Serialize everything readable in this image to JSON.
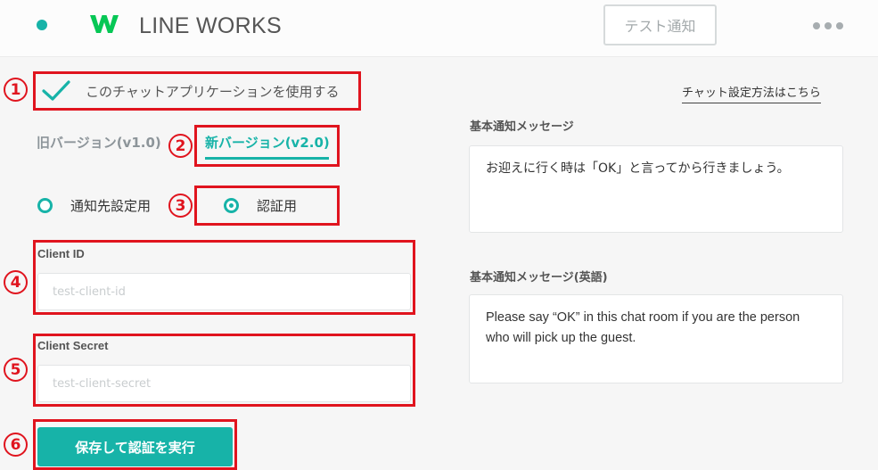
{
  "header": {
    "brand": "LINE WORKS",
    "test_button": "テスト通知"
  },
  "settings": {
    "enable_label": "このチャットアプリケーションを使用する",
    "howto_link": "チャット設定方法はこちら",
    "tabs": {
      "old": "旧バージョン(v1.0)",
      "new": "新バージョン(v2.0)"
    },
    "radios": {
      "notify": "通知先設定用",
      "auth": "認証用"
    },
    "client_id": {
      "label": "Client ID",
      "placeholder": "test-client-id"
    },
    "client_secret": {
      "label": "Client Secret",
      "placeholder": "test-client-secret"
    },
    "submit": "保存して認証を実行"
  },
  "messages": {
    "basic_label": "基本通知メッセージ",
    "basic_text": "お迎えに行く時は「OK」と言ってから行きましょう。",
    "english_label": "基本通知メッセージ(英語)",
    "english_text": "Please say “OK” in this chat room if you are the person who will pick up the guest."
  },
  "annotations": {
    "n1": "1",
    "n2": "2",
    "n3": "3",
    "n4": "4",
    "n5": "5",
    "n6": "6"
  },
  "colors": {
    "accent": "#17b3a8",
    "annotation_red": "#e0141e",
    "logo_green": "#06c755"
  }
}
